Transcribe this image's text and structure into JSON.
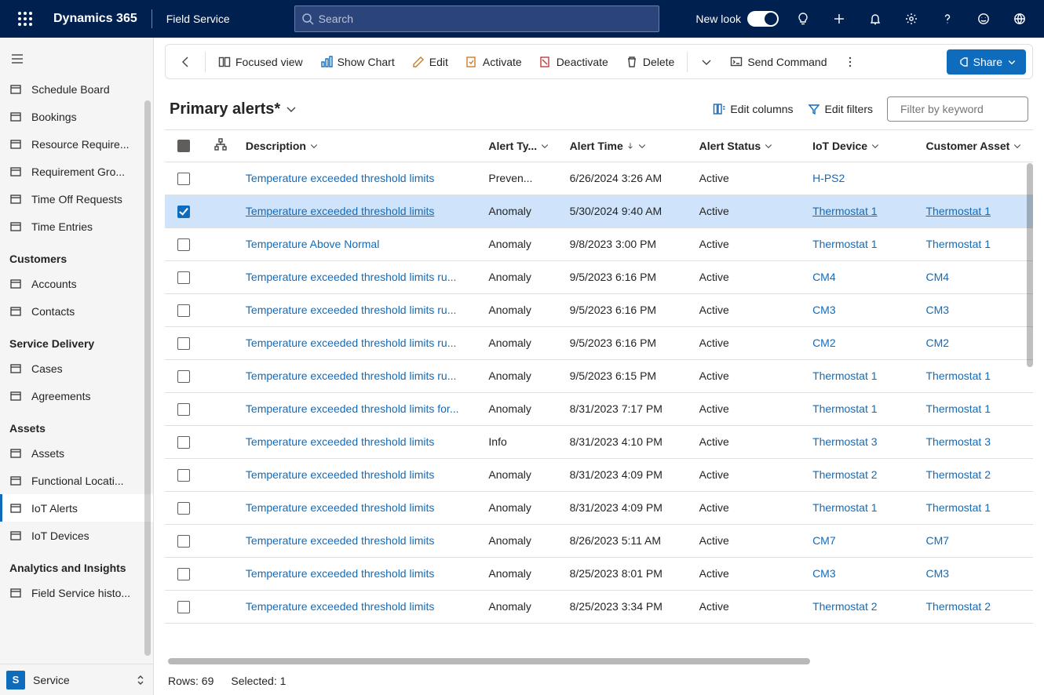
{
  "header": {
    "product": "Dynamics 365",
    "app": "Field Service",
    "search_placeholder": "Search",
    "newlook_label": "New look"
  },
  "sidebar": {
    "groups": [
      {
        "items": [
          {
            "label": "Schedule Board"
          },
          {
            "label": "Bookings"
          },
          {
            "label": "Resource Require..."
          },
          {
            "label": "Requirement Gro..."
          },
          {
            "label": "Time Off Requests"
          },
          {
            "label": "Time Entries"
          }
        ]
      },
      {
        "header": "Customers",
        "items": [
          {
            "label": "Accounts"
          },
          {
            "label": "Contacts"
          }
        ]
      },
      {
        "header": "Service Delivery",
        "items": [
          {
            "label": "Cases"
          },
          {
            "label": "Agreements"
          }
        ]
      },
      {
        "header": "Assets",
        "items": [
          {
            "label": "Assets"
          },
          {
            "label": "Functional Locati..."
          },
          {
            "label": "IoT Alerts",
            "active": true
          },
          {
            "label": "IoT Devices"
          }
        ]
      },
      {
        "header": "Analytics and Insights",
        "items": [
          {
            "label": "Field Service histo..."
          }
        ]
      }
    ],
    "switcher": {
      "initial": "S",
      "name": "Service"
    }
  },
  "commands": {
    "focused": "Focused view",
    "chart": "Show Chart",
    "edit": "Edit",
    "activate": "Activate",
    "deactivate": "Deactivate",
    "delete": "Delete",
    "sendcmd": "Send Command",
    "share": "Share"
  },
  "view": {
    "title": "Primary alerts*",
    "edit_columns": "Edit columns",
    "edit_filters": "Edit filters",
    "filter_placeholder": "Filter by keyword"
  },
  "columns": {
    "desc": "Description",
    "type": "Alert Ty...",
    "time": "Alert Time",
    "status": "Alert Status",
    "device": "IoT Device",
    "asset": "Customer Asset"
  },
  "rows": [
    {
      "desc": "Temperature exceeded threshold limits",
      "type": "Preven...",
      "time": "6/26/2024 3:26 AM",
      "status": "Active",
      "device": "H-PS2",
      "asset": ""
    },
    {
      "desc": "Temperature exceeded threshold limits",
      "type": "Anomaly",
      "time": "5/30/2024 9:40 AM",
      "status": "Active",
      "device": "Thermostat 1",
      "asset": "Thermostat 1",
      "selected": true
    },
    {
      "desc": "Temperature Above Normal",
      "type": "Anomaly",
      "time": "9/8/2023 3:00 PM",
      "status": "Active",
      "device": "Thermostat 1",
      "asset": "Thermostat 1"
    },
    {
      "desc": "Temperature exceeded threshold limits ru...",
      "type": "Anomaly",
      "time": "9/5/2023 6:16 PM",
      "status": "Active",
      "device": "CM4",
      "asset": "CM4"
    },
    {
      "desc": "Temperature exceeded threshold limits ru...",
      "type": "Anomaly",
      "time": "9/5/2023 6:16 PM",
      "status": "Active",
      "device": "CM3",
      "asset": "CM3"
    },
    {
      "desc": "Temperature exceeded threshold limits ru...",
      "type": "Anomaly",
      "time": "9/5/2023 6:16 PM",
      "status": "Active",
      "device": "CM2",
      "asset": "CM2"
    },
    {
      "desc": "Temperature exceeded threshold limits ru...",
      "type": "Anomaly",
      "time": "9/5/2023 6:15 PM",
      "status": "Active",
      "device": "Thermostat 1",
      "asset": "Thermostat 1"
    },
    {
      "desc": "Temperature exceeded threshold limits for...",
      "type": "Anomaly",
      "time": "8/31/2023 7:17 PM",
      "status": "Active",
      "device": "Thermostat 1",
      "asset": "Thermostat 1"
    },
    {
      "desc": "Temperature exceeded threshold limits",
      "type": "Info",
      "time": "8/31/2023 4:10 PM",
      "status": "Active",
      "device": "Thermostat 3",
      "asset": "Thermostat 3"
    },
    {
      "desc": "Temperature exceeded threshold limits",
      "type": "Anomaly",
      "time": "8/31/2023 4:09 PM",
      "status": "Active",
      "device": "Thermostat 2",
      "asset": "Thermostat 2"
    },
    {
      "desc": "Temperature exceeded threshold limits",
      "type": "Anomaly",
      "time": "8/31/2023 4:09 PM",
      "status": "Active",
      "device": "Thermostat 1",
      "asset": "Thermostat 1"
    },
    {
      "desc": "Temperature exceeded threshold limits",
      "type": "Anomaly",
      "time": "8/26/2023 5:11 AM",
      "status": "Active",
      "device": "CM7",
      "asset": "CM7"
    },
    {
      "desc": "Temperature exceeded threshold limits",
      "type": "Anomaly",
      "time": "8/25/2023 8:01 PM",
      "status": "Active",
      "device": "CM3",
      "asset": "CM3"
    },
    {
      "desc": "Temperature exceeded threshold limits",
      "type": "Anomaly",
      "time": "8/25/2023 3:34 PM",
      "status": "Active",
      "device": "Thermostat 2",
      "asset": "Thermostat 2"
    }
  ],
  "footer": {
    "rows": "Rows: 69",
    "selected": "Selected: 1"
  }
}
